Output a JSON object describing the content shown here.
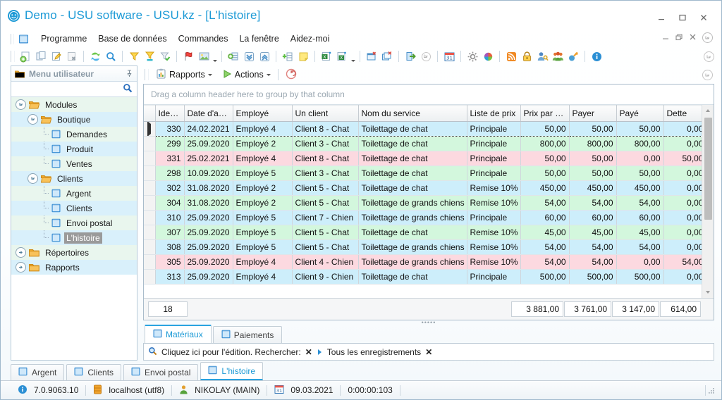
{
  "window": {
    "title": "Demo - USU software - USU.kz - [L'histoire]",
    "logo_icon": "usu-logo-icon",
    "minimize_label": "minimize",
    "maximize_label": "maximize",
    "close_label": "close"
  },
  "menubar": {
    "app_icon": "application-icon",
    "items": [
      {
        "label": "Programme",
        "name": "menu-programme"
      },
      {
        "label": "Base de données",
        "name": "menu-base-de-donnees"
      },
      {
        "label": "Commandes",
        "name": "menu-commandes"
      },
      {
        "label": "La fenêtre",
        "name": "menu-la-fenetre"
      },
      {
        "label": "Aidez-moi",
        "name": "menu-aidez-moi"
      }
    ]
  },
  "toolbar": {
    "buttons": [
      {
        "name": "add-record-icon"
      },
      {
        "name": "copy-record-icon"
      },
      {
        "name": "edit-record-icon"
      },
      {
        "name": "delete-record-icon"
      },
      {
        "name": "refresh-icon"
      },
      {
        "name": "search-icon"
      },
      {
        "name": "filter-icon"
      },
      {
        "name": "filter-active-icon"
      },
      {
        "name": "filter-check-icon"
      },
      {
        "name": "flag-icon"
      },
      {
        "name": "image-icon"
      },
      {
        "name": "expand-group-icon"
      },
      {
        "name": "collapse-all-icon"
      },
      {
        "name": "expand-all-icon"
      },
      {
        "name": "add-column-icon"
      },
      {
        "name": "note-icon"
      },
      {
        "name": "export-excel-icon"
      },
      {
        "name": "export-excel-2-icon"
      },
      {
        "name": "new-window-icon"
      },
      {
        "name": "close-window-icon"
      },
      {
        "name": "exit-icon"
      },
      {
        "name": "rollup-icon"
      },
      {
        "name": "calendar-icon"
      },
      {
        "name": "settings-icon"
      },
      {
        "name": "color-wheel-icon"
      },
      {
        "name": "rss-icon"
      },
      {
        "name": "lock-icon"
      },
      {
        "name": "user-key-icon"
      },
      {
        "name": "users-group-icon"
      },
      {
        "name": "plug-icon"
      },
      {
        "name": "info-icon"
      }
    ]
  },
  "sidebar": {
    "header_title": "Menu utilisateur",
    "header_icon": "folder-icon",
    "pin_icon": "pin-icon",
    "search_value": "",
    "search_placeholder": "",
    "search_icon": "search-icon",
    "tree": [
      {
        "label": "Modules",
        "level": 0,
        "type": "folder-open",
        "expanded": true,
        "selected": false
      },
      {
        "label": "Boutique",
        "level": 1,
        "type": "folder-open",
        "expanded": true,
        "selected": false
      },
      {
        "label": "Demandes",
        "level": 2,
        "type": "module",
        "expanded": null,
        "selected": false
      },
      {
        "label": "Produit",
        "level": 2,
        "type": "module",
        "expanded": null,
        "selected": false
      },
      {
        "label": "Ventes",
        "level": 2,
        "type": "module",
        "expanded": null,
        "selected": false
      },
      {
        "label": "Clients",
        "level": 1,
        "type": "folder-open",
        "expanded": true,
        "selected": false
      },
      {
        "label": "Argent",
        "level": 2,
        "type": "module",
        "expanded": null,
        "selected": false
      },
      {
        "label": "Clients",
        "level": 2,
        "type": "module",
        "expanded": null,
        "selected": false
      },
      {
        "label": "Envoi postal",
        "level": 2,
        "type": "module",
        "expanded": null,
        "selected": false
      },
      {
        "label": "L'histoire",
        "level": 2,
        "type": "module",
        "expanded": null,
        "selected": true
      },
      {
        "label": "Répertoires",
        "level": 0,
        "type": "folder",
        "expanded": false,
        "selected": false
      },
      {
        "label": "Rapports",
        "level": 0,
        "type": "folder",
        "expanded": false,
        "selected": false
      }
    ]
  },
  "main_toolbar": {
    "reports_label": "Rapports",
    "reports_icon": "report-icon",
    "actions_label": "Actions",
    "actions_icon": "play-icon",
    "undo_icon": "undo-icon"
  },
  "grid": {
    "group_panel_text": "Drag a column header here to group by that column",
    "columns": [
      {
        "key": "id",
        "label": "Identif...",
        "align": "right"
      },
      {
        "key": "date",
        "label": "Date d'arrivée",
        "align": "left"
      },
      {
        "key": "emp",
        "label": "Employé",
        "align": "left"
      },
      {
        "key": "client",
        "label": "Un client",
        "align": "left"
      },
      {
        "key": "service",
        "label": "Nom du service",
        "align": "left"
      },
      {
        "key": "price",
        "label": "Liste de prix",
        "align": "left"
      },
      {
        "key": "unit",
        "label": "Prix par prix",
        "align": "right"
      },
      {
        "key": "pay",
        "label": "Payer",
        "align": "right"
      },
      {
        "key": "paid",
        "label": "Payé",
        "align": "right"
      },
      {
        "key": "debt",
        "label": "Dette",
        "align": "right"
      }
    ],
    "rows": [
      {
        "color": "blue",
        "selected": true,
        "id": "330",
        "date": "24.02.2021",
        "emp": "Employé 4",
        "client": "Client 8 - Chat",
        "service": "Toilettage de chat",
        "price": "Principale",
        "unit": "50,00",
        "pay": "50,00",
        "paid": "50,00",
        "debt": "0,00"
      },
      {
        "color": "green",
        "selected": false,
        "id": "299",
        "date": "25.09.2020",
        "emp": "Employé 2",
        "client": "Client 3 - Chat",
        "service": "Toilettage de chat",
        "price": "Principale",
        "unit": "800,00",
        "pay": "800,00",
        "paid": "800,00",
        "debt": "0,00"
      },
      {
        "color": "pink",
        "selected": false,
        "id": "331",
        "date": "25.02.2021",
        "emp": "Employé 4",
        "client": "Client 8 - Chat",
        "service": "Toilettage de chat",
        "price": "Principale",
        "unit": "50,00",
        "pay": "50,00",
        "paid": "0,00",
        "debt": "50,00"
      },
      {
        "color": "green",
        "selected": false,
        "id": "298",
        "date": "10.09.2020",
        "emp": "Employé 5",
        "client": "Client 3 - Chat",
        "service": "Toilettage de chat",
        "price": "Principale",
        "unit": "50,00",
        "pay": "50,00",
        "paid": "50,00",
        "debt": "0,00"
      },
      {
        "color": "blue",
        "selected": false,
        "id": "302",
        "date": "31.08.2020",
        "emp": "Employé 2",
        "client": "Client 5 - Chat",
        "service": "Toilettage de chat",
        "price": "Remise 10%",
        "unit": "450,00",
        "pay": "450,00",
        "paid": "450,00",
        "debt": "0,00"
      },
      {
        "color": "green",
        "selected": false,
        "id": "304",
        "date": "31.08.2020",
        "emp": "Employé 2",
        "client": "Client 5 - Chat",
        "service": "Toilettage de grands chiens",
        "price": "Remise 10%",
        "unit": "54,00",
        "pay": "54,00",
        "paid": "54,00",
        "debt": "0,00"
      },
      {
        "color": "blue",
        "selected": false,
        "id": "310",
        "date": "25.09.2020",
        "emp": "Employé 5",
        "client": "Client 7 - Chien",
        "service": "Toilettage de grands chiens",
        "price": "Principale",
        "unit": "60,00",
        "pay": "60,00",
        "paid": "60,00",
        "debt": "0,00"
      },
      {
        "color": "green",
        "selected": false,
        "id": "307",
        "date": "25.09.2020",
        "emp": "Employé 5",
        "client": "Client 5 - Chat",
        "service": "Toilettage de chat",
        "price": "Remise 10%",
        "unit": "45,00",
        "pay": "45,00",
        "paid": "45,00",
        "debt": "0,00"
      },
      {
        "color": "blue",
        "selected": false,
        "id": "308",
        "date": "25.09.2020",
        "emp": "Employé 5",
        "client": "Client 5 - Chat",
        "service": "Toilettage de grands chiens",
        "price": "Remise 10%",
        "unit": "54,00",
        "pay": "54,00",
        "paid": "54,00",
        "debt": "0,00"
      },
      {
        "color": "pink",
        "selected": false,
        "id": "305",
        "date": "25.09.2020",
        "emp": "Employé 4",
        "client": "Client 4 - Chien",
        "service": "Toilettage de grands chiens",
        "price": "Remise 10%",
        "unit": "54,00",
        "pay": "54,00",
        "paid": "0,00",
        "debt": "54,00"
      },
      {
        "color": "blue",
        "selected": false,
        "id": "313",
        "date": "25.09.2020",
        "emp": "Employé 4",
        "client": "Client 9 - Chien",
        "service": "Toilettage de chat",
        "price": "Principale",
        "unit": "500,00",
        "pay": "500,00",
        "paid": "500,00",
        "debt": "0,00"
      }
    ],
    "summary": {
      "count": "18",
      "unit_total": "3 881,00",
      "pay_total": "3 761,00",
      "paid_total": "3 147,00",
      "debt_total": "614,00"
    }
  },
  "detail": {
    "tabs": [
      {
        "label": "Matériaux",
        "icon": "module-icon",
        "active": true
      },
      {
        "label": "Paiements",
        "icon": "module-icon",
        "active": false
      }
    ],
    "filter": {
      "icon": "search-icon",
      "text": "Cliquez ici pour l'édition. Rechercher:",
      "clear_label": "✕",
      "records_label": "Tous les enregistrements",
      "records_clear_label": "✕"
    }
  },
  "window_tabs": [
    {
      "label": "Argent",
      "icon": "module-icon",
      "active": false
    },
    {
      "label": "Clients",
      "icon": "module-icon",
      "active": false
    },
    {
      "label": "Envoi postal",
      "icon": "module-icon",
      "active": false
    },
    {
      "label": "L'histoire",
      "icon": "module-icon",
      "active": true
    }
  ],
  "statusbar": {
    "version_icon": "info-icon",
    "version": "7.0.9063.10",
    "db_icon": "database-icon",
    "db": "localhost (utf8)",
    "user_icon": "user-icon",
    "user": "NIKOLAY (MAIN)",
    "date_icon": "calendar-icon",
    "date": "09.03.2021",
    "time": "0:00:00:103"
  },
  "colors": {
    "accent": "#1c9ad6",
    "row_blue": "#cdeefb",
    "row_green": "#d3f7dd",
    "row_pink": "#fcd9e0",
    "selection": "#9a9a9a"
  }
}
